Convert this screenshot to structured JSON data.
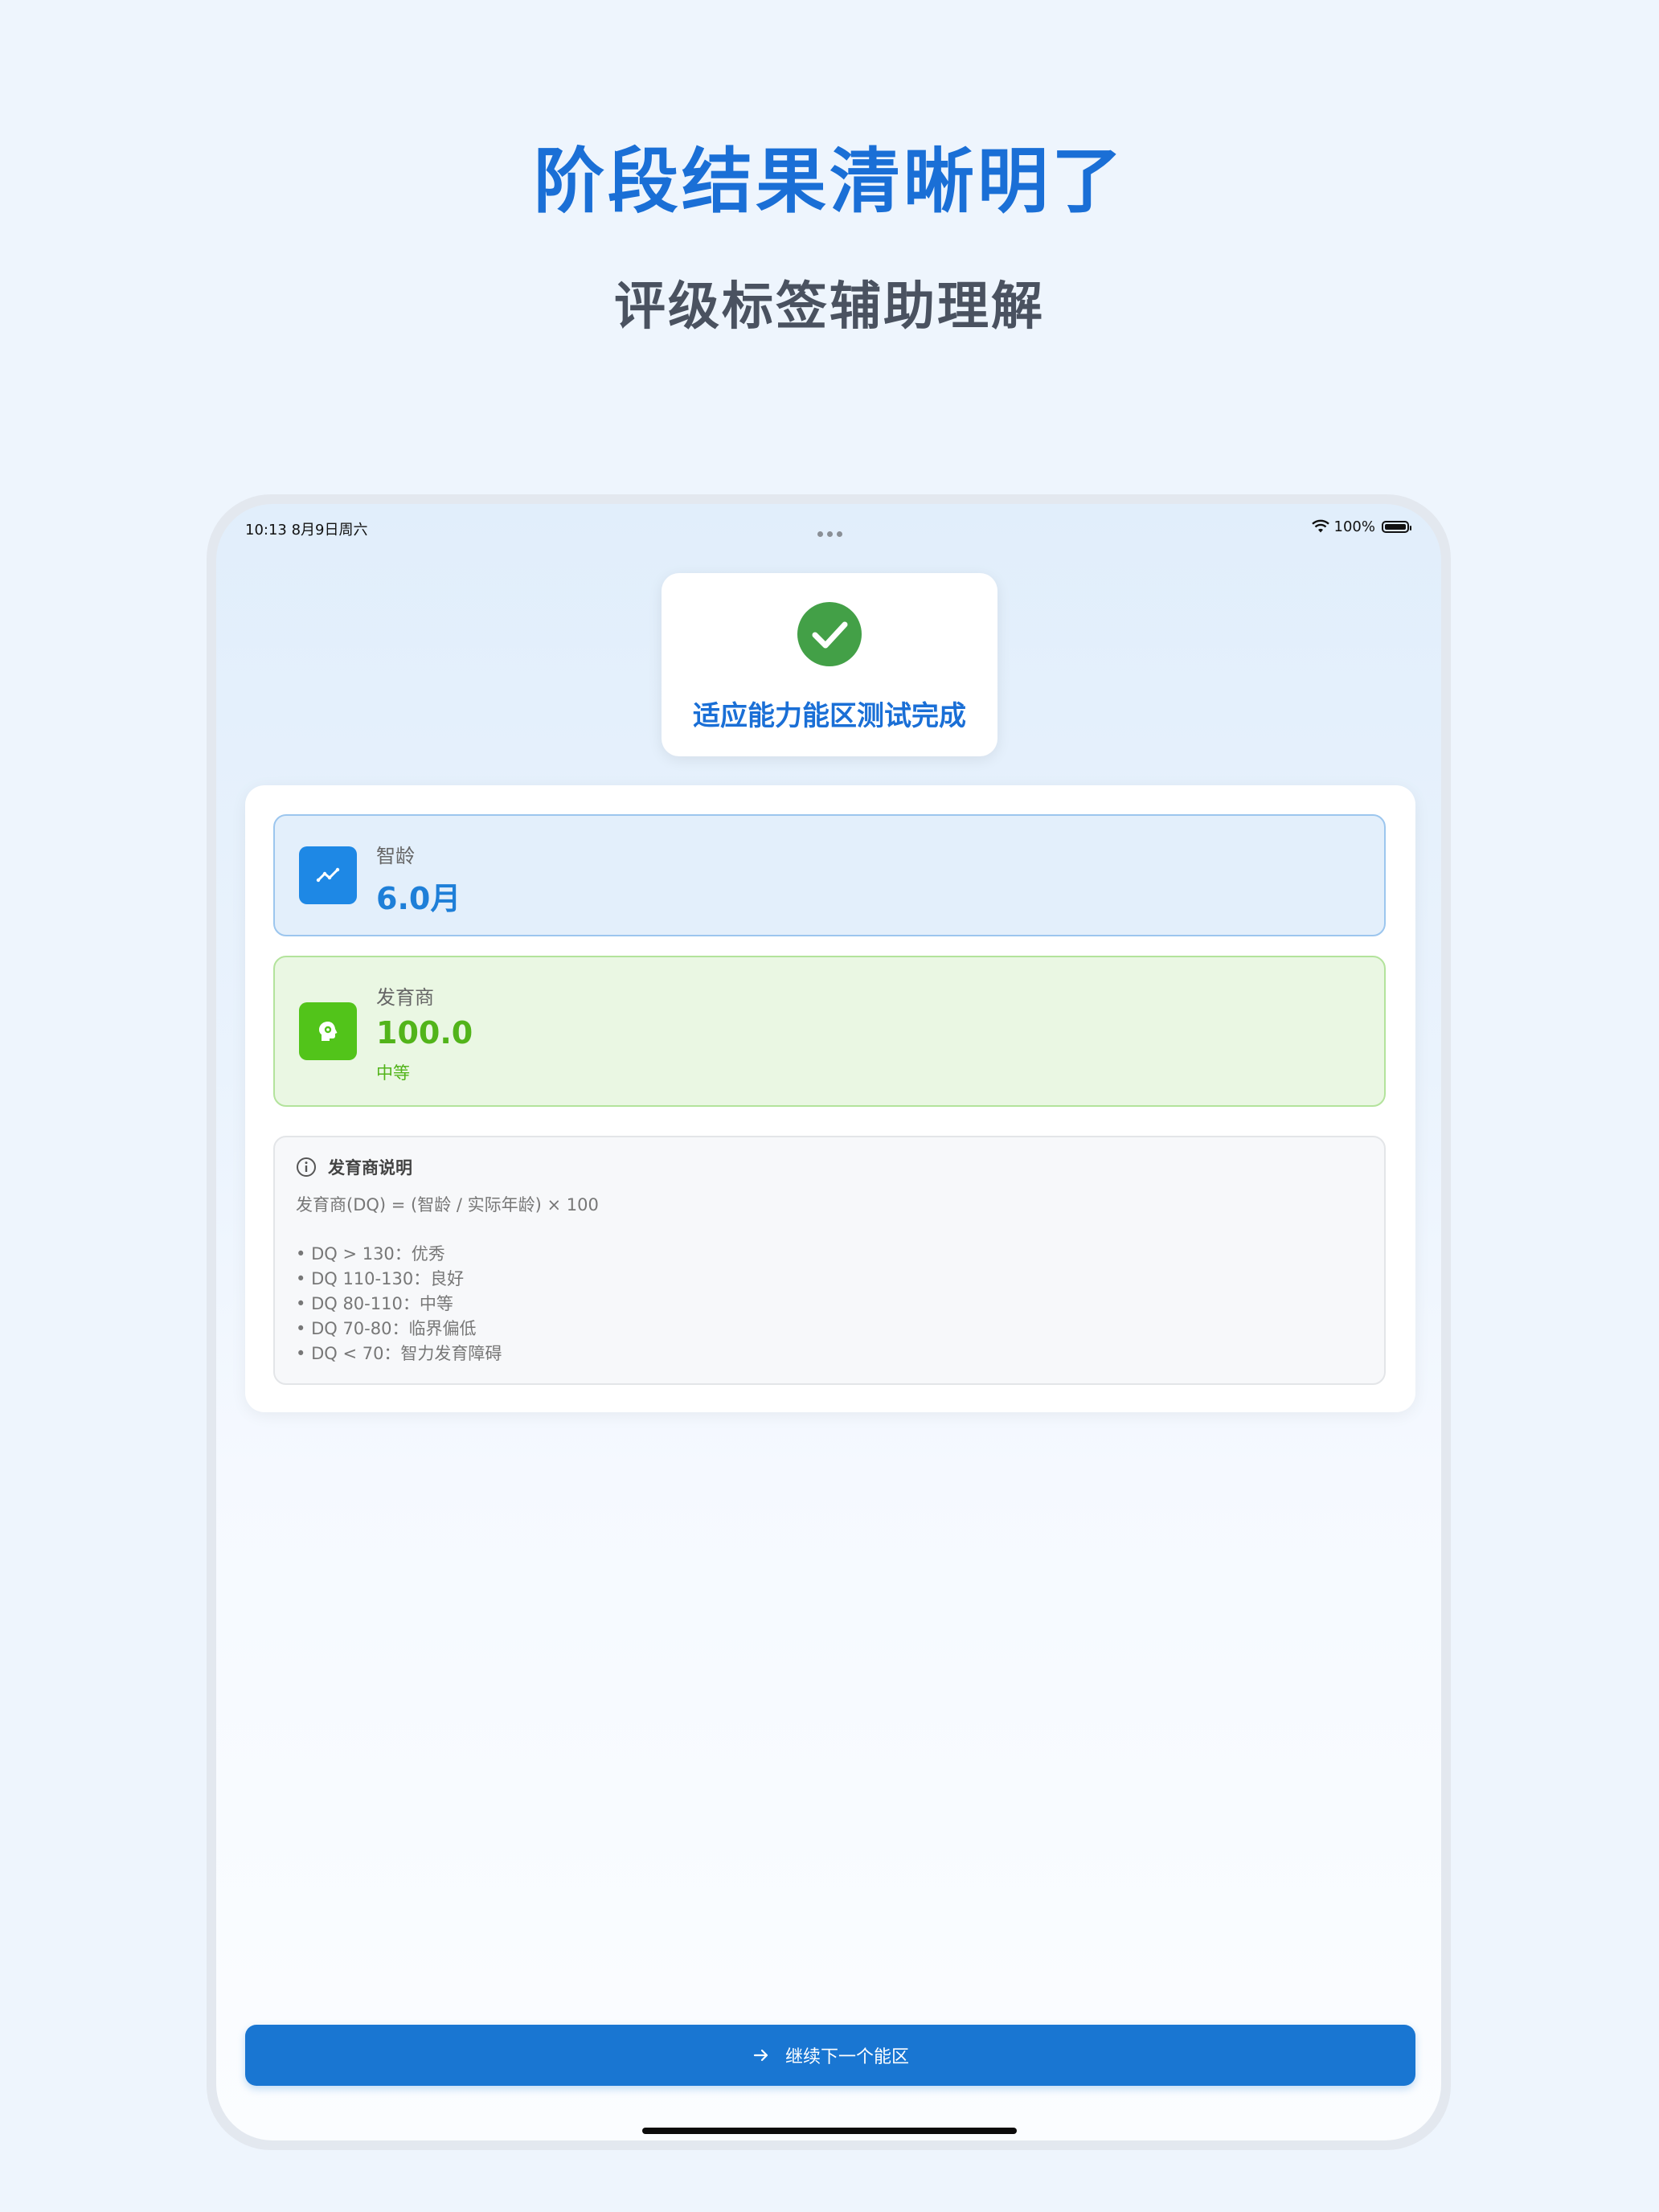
{
  "promo": {
    "title": "阶段结果清晰明了",
    "subtitle": "评级标签辅助理解"
  },
  "status_bar": {
    "time": "10:13  8月9日周六",
    "battery": "100%"
  },
  "completion": {
    "title": "适应能力能区测试完成",
    "icon": "check-circle-icon"
  },
  "metrics": {
    "mental_age": {
      "label": "智龄",
      "value": "6.0月",
      "icon": "trend-line-icon"
    },
    "dq": {
      "label": "发育商",
      "value": "100.0",
      "grade": "中等",
      "icon": "brain-icon"
    }
  },
  "explanation": {
    "title": "发育商说明",
    "formula": "发育商(DQ) = (智龄 / 实际年龄) × 100",
    "items": [
      "DQ > 130：优秀",
      "DQ 110-130：良好",
      "DQ 80-110：中等",
      "DQ 70-80：临界偏低",
      "DQ < 70：智力发育障碍"
    ]
  },
  "action": {
    "next_label": "继续下一个能区"
  },
  "colors": {
    "accent": "#1a6fd6",
    "primary_button": "#1976d2",
    "success": "#52c41a",
    "check": "#43a047"
  }
}
